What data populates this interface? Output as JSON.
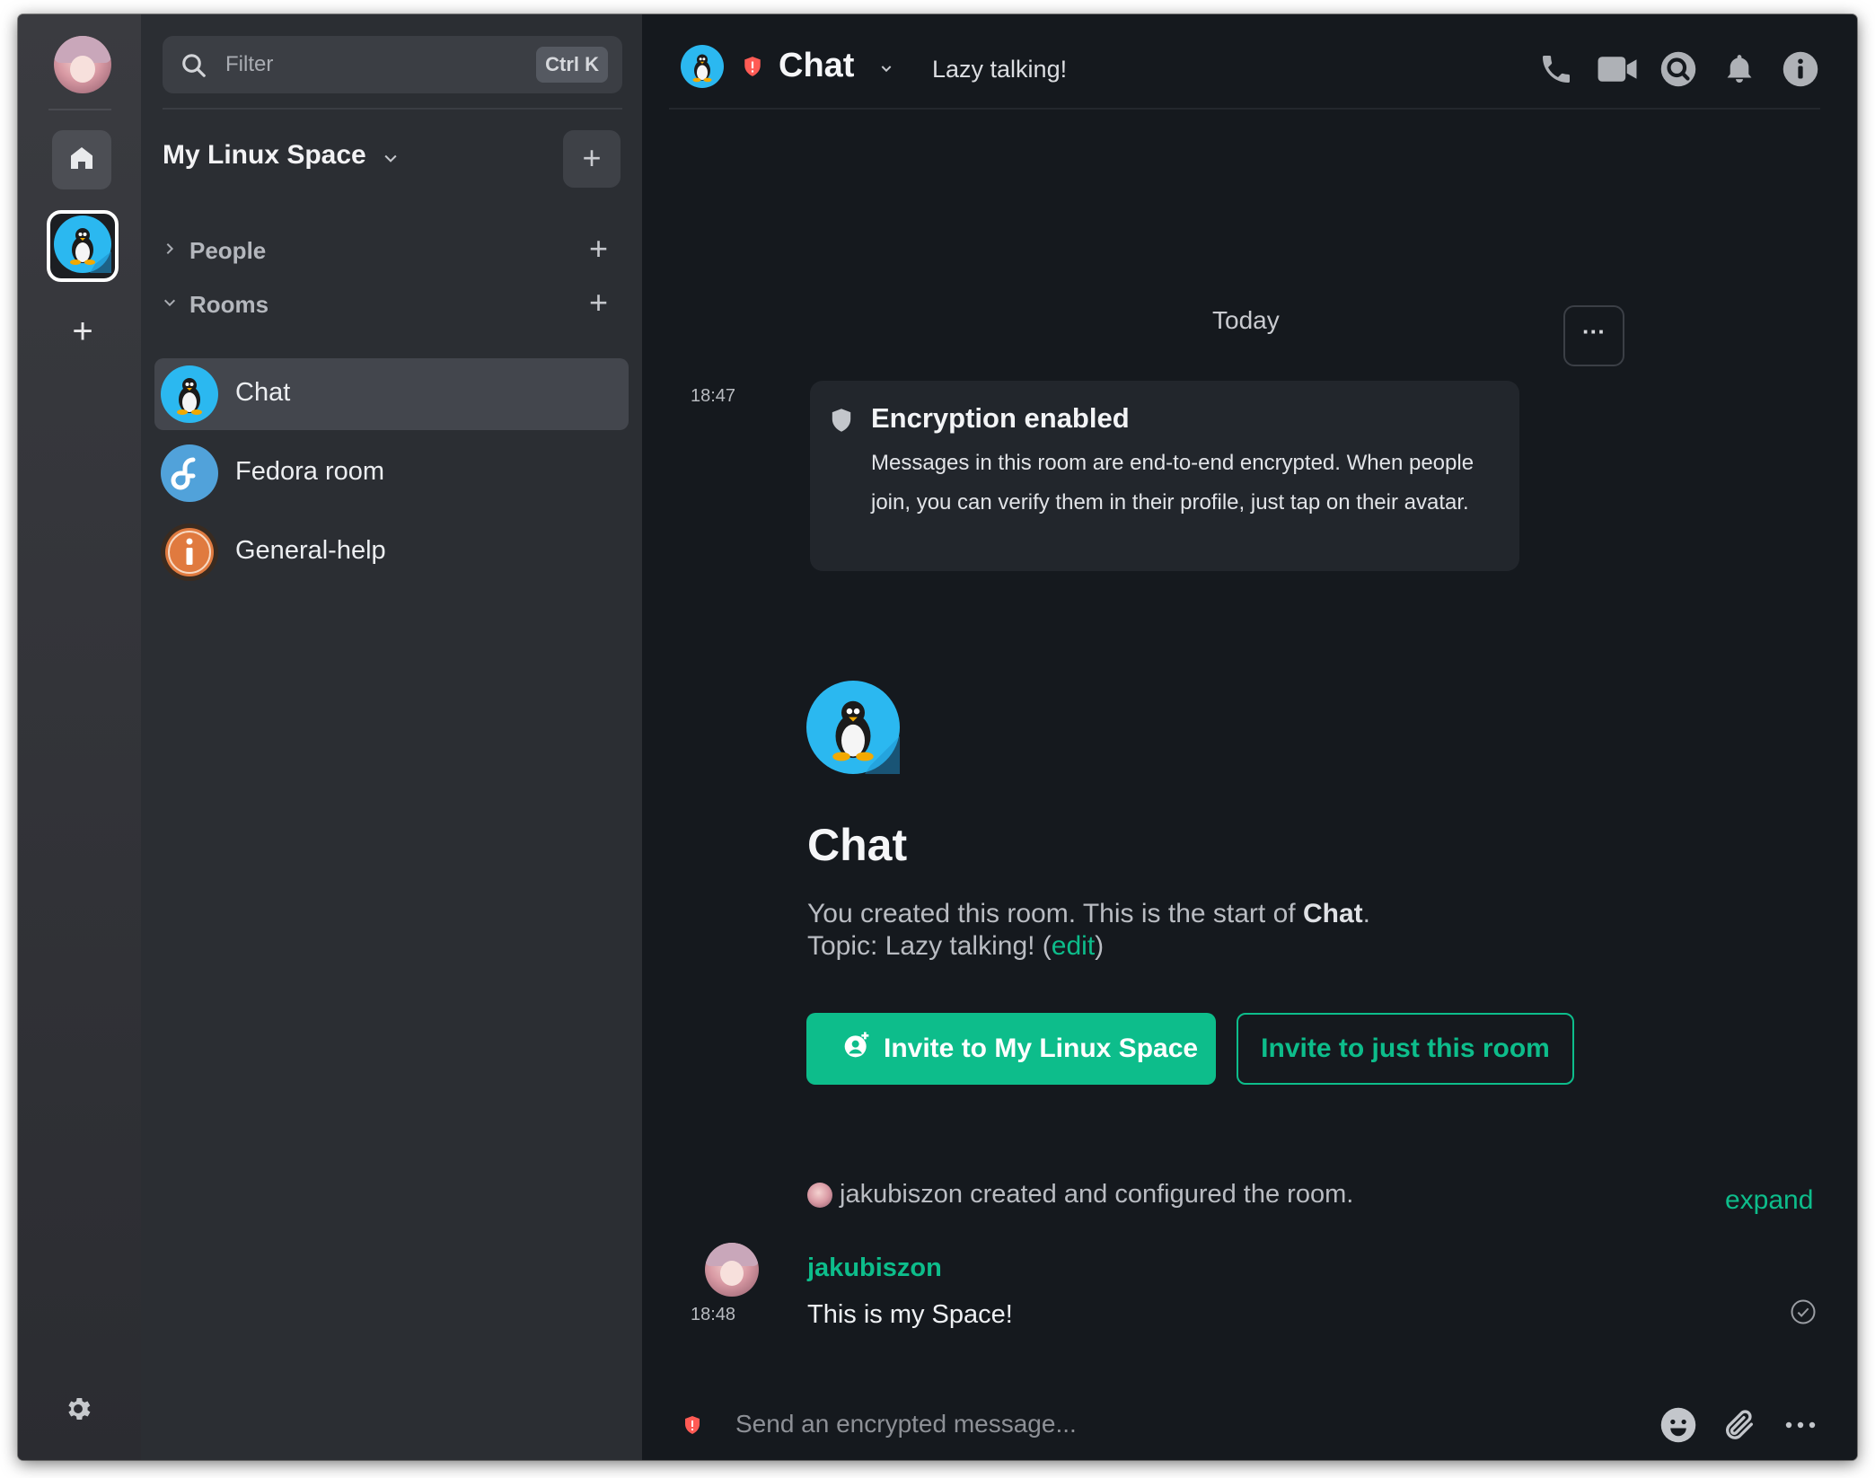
{
  "filter": {
    "placeholder": "Filter",
    "shortcut": "Ctrl K"
  },
  "space": {
    "name": "My Linux Space"
  },
  "sections": {
    "people": "People",
    "rooms": "Rooms"
  },
  "rooms": [
    {
      "name": "Chat",
      "icon": "tux-icon",
      "active": true
    },
    {
      "name": "Fedora room",
      "icon": "fedora-icon",
      "active": false
    },
    {
      "name": "General-help",
      "icon": "info-icon",
      "active": false
    }
  ],
  "header": {
    "title": "Chat",
    "topic": "Lazy talking!"
  },
  "timeline": {
    "date_separator": "Today",
    "encryption_time": "18:47",
    "encryption_title": "Encryption enabled",
    "encryption_body": "Messages in this room are end-to-end encrypted. When people join, you can verify them in their profile, just tap on their avatar.",
    "intro_title": "Chat",
    "intro_created_prefix": "You created this room. This is the start of ",
    "intro_created_room": "Chat",
    "intro_created_suffix": ".",
    "intro_topic_prefix": "Topic: Lazy talking! (",
    "intro_topic_edit": "edit",
    "intro_topic_suffix": ")",
    "invite_space_label": "Invite to My Linux Space",
    "invite_room_label": "Invite to just this room",
    "summary_text": "jakubiszon created and configured the room.",
    "expand_label": "expand",
    "message": {
      "sender": "jakubiszon",
      "time": "18:48",
      "body": "This is my Space!"
    }
  },
  "composer": {
    "placeholder": "Send an encrypted message..."
  },
  "colors": {
    "accent": "#0dbd8b",
    "background": "#15191e",
    "sidebar": "#2b2e33",
    "rail": "#333439",
    "alert": "#ff5b55"
  },
  "icons": {
    "header": [
      "phone-icon",
      "video-icon",
      "search-icon",
      "bell-icon",
      "info-icon"
    ],
    "composer": [
      "emoji-icon",
      "attachment-icon",
      "more-options-icon"
    ]
  }
}
